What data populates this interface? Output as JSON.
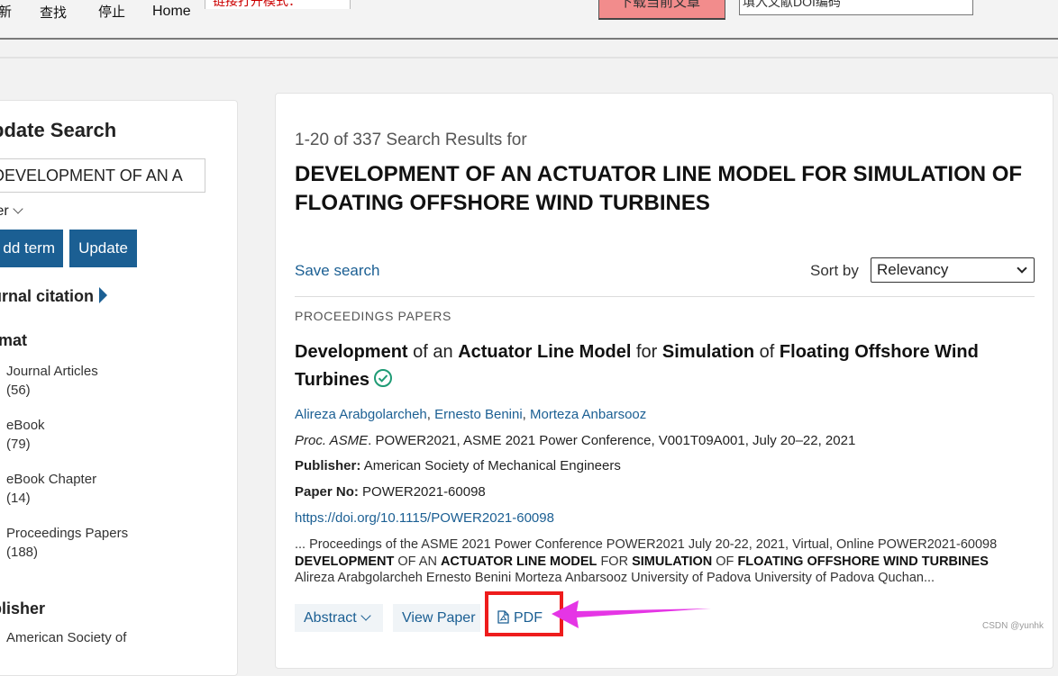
{
  "toolbar": {
    "refresh_label": "新",
    "find_label": "查找",
    "stop_label": "停止",
    "home_label": "Home",
    "mode_text": "链接打开模式：",
    "download_label": "下载当前文章",
    "doi_placeholder": "填入文献DOI编码"
  },
  "sidebar": {
    "title": "pdate Search",
    "search_value": "DEVELOPMENT OF AN A",
    "filter_label": "ter",
    "add_term_label": "dd term",
    "update_label": "Update",
    "journal_citation_label": "urnal citation",
    "format_title": "rmat",
    "formats": [
      {
        "label": "Journal Articles",
        "count": "(56)"
      },
      {
        "label": "eBook",
        "count": "(79)"
      },
      {
        "label": "eBook Chapter",
        "count": "(14)"
      },
      {
        "label": "Proceedings Papers",
        "count": "(188)"
      }
    ],
    "publisher_title": "blisher",
    "publisher_item": "American Society of"
  },
  "main": {
    "results_count": "1-20 of 337 Search Results for",
    "query_title": "DEVELOPMENT OF AN ACTUATOR LINE MODEL FOR SIMULATION OF FLOATING OFFSHORE WIND TURBINES",
    "save_search": "Save search",
    "sort_label": "Sort by",
    "sort_value": "Relevancy",
    "result": {
      "type": "PROCEEDINGS PAPERS",
      "title_parts": [
        "Development",
        " of an ",
        "Actuator Line Model",
        " for ",
        "Simulation",
        " of ",
        "Floating Offshore Wind Turbines"
      ],
      "authors": [
        "Alireza Arabgolarcheh",
        "Ernesto Benini",
        "Morteza Anbarsooz"
      ],
      "author_sep": ", ",
      "citation_journal": "Proc. ASME",
      "citation_rest": ". POWER2021, ASME 2021 Power Conference, V001T09A001, July 20–22, 2021",
      "publisher_label": "Publisher:",
      "publisher_value": " American Society of Mechanical Engineers",
      "paperno_label": "Paper No:",
      "paperno_value": " POWER2021-60098",
      "doi": "https://doi.org/10.1115/POWER2021-60098",
      "snippet_line1": "... Proceedings of the ASME 2021 Power Conference POWER2021 July 20-22, 2021, Virtual, Online POWER2021-60098",
      "snippet_line2_parts": [
        "DEVELOPMENT",
        " OF AN ",
        "ACTUATOR LINE MODEL",
        " FOR ",
        "SIMULATION",
        " OF ",
        "FLOATING OFFSHORE WIND TURBINES"
      ],
      "snippet_line3": "Alireza Arabgolarcheh Ernesto Benini Morteza Anbarsooz University of Padova University of Padova Quchan...",
      "abstract_label": "Abstract",
      "view_paper_label": "View Paper",
      "pdf_label": "PDF"
    }
  },
  "watermark": "CSDN @yunhk",
  "colors": {
    "link": "#1b5f93",
    "highlight": "#ee1c1c",
    "annotation_arrow": "#e535e5"
  }
}
